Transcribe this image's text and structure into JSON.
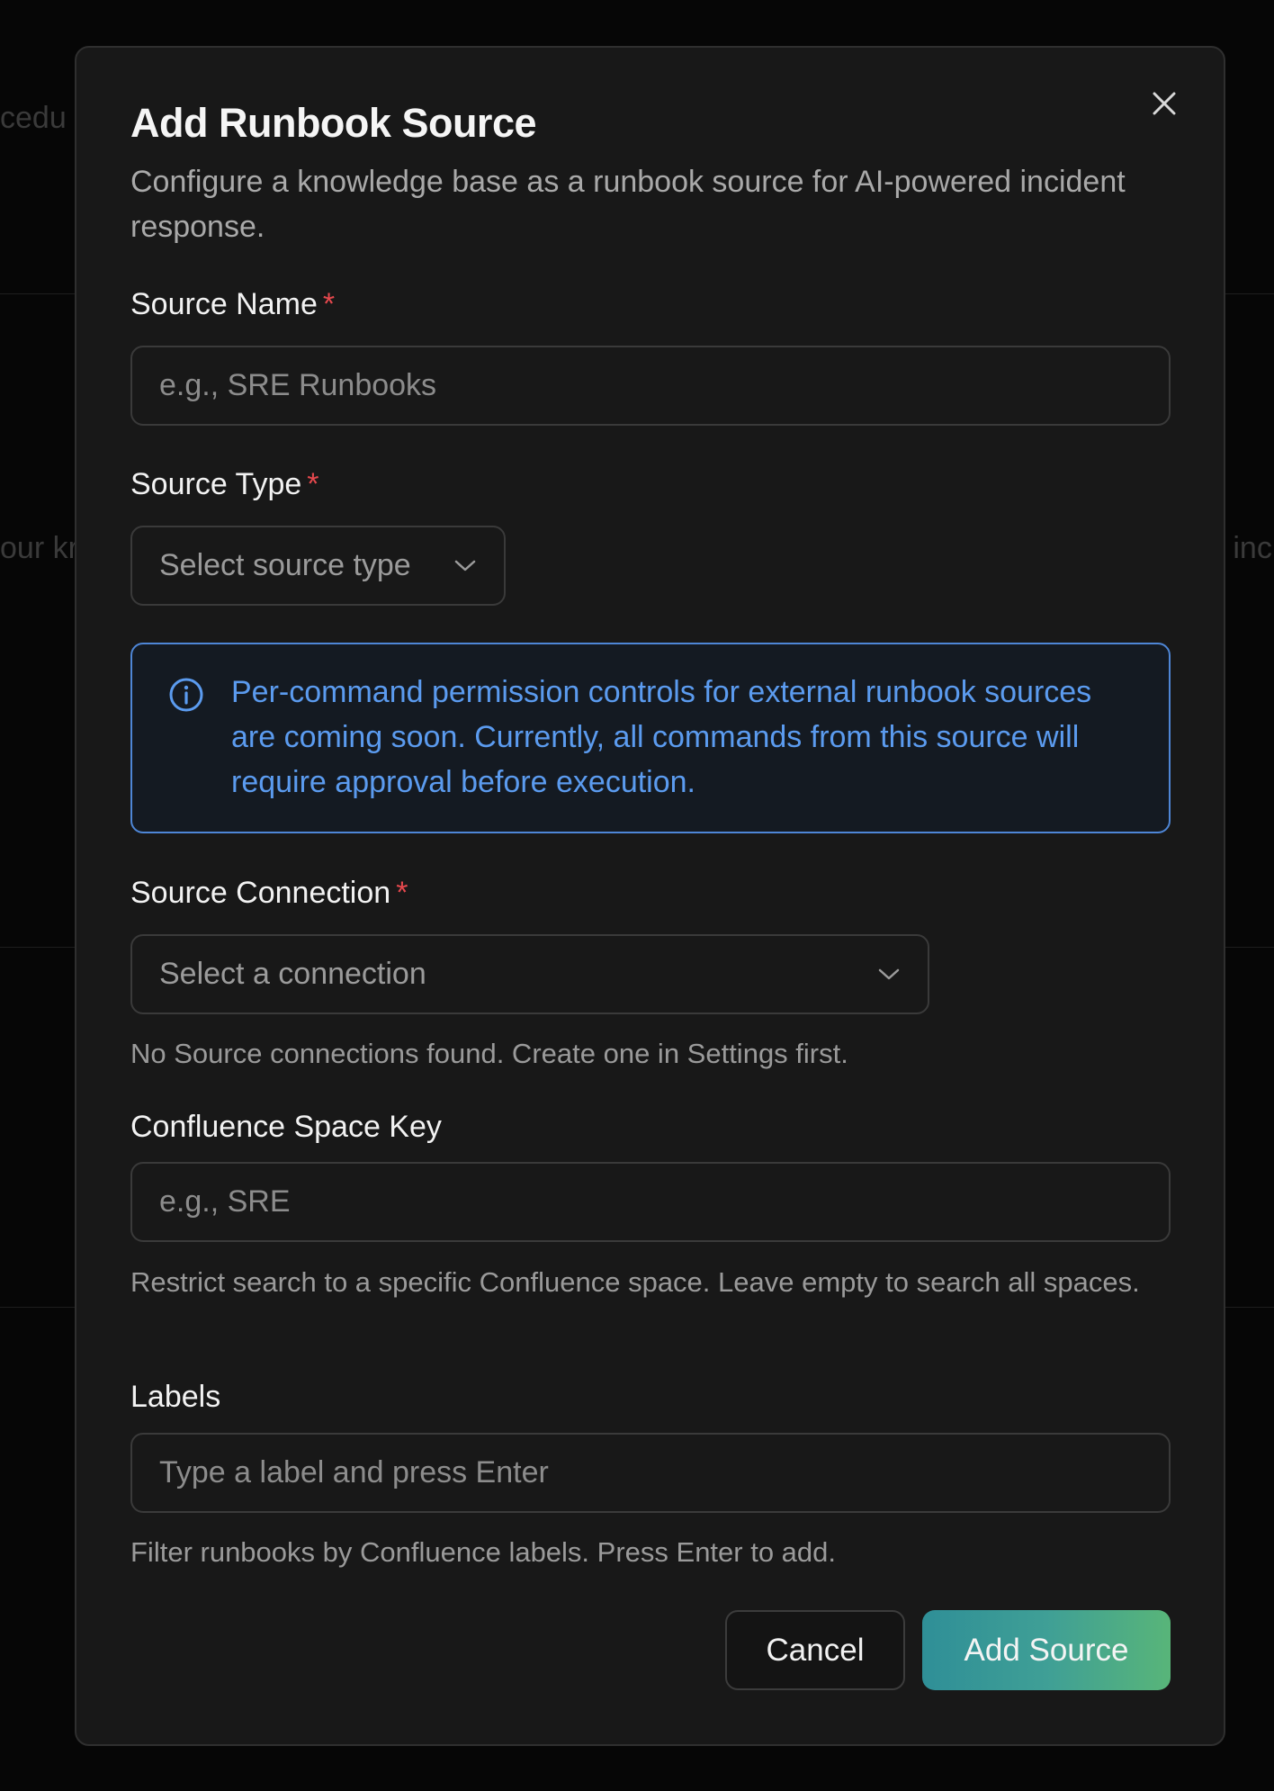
{
  "background": {
    "text_left_top": "cedu",
    "text_left_mid": "our kr",
    "text_right_mid": "g inc"
  },
  "dialog": {
    "title": "Add Runbook Source",
    "description": "Configure a knowledge base as a runbook source for AI-powered incident response.",
    "close_icon": "close-icon"
  },
  "source_name": {
    "label": "Source Name",
    "required_mark": "*",
    "placeholder": "e.g., SRE Runbooks",
    "value": ""
  },
  "source_type": {
    "label": "Source Type",
    "required_mark": "*",
    "selected": "Select source type",
    "icon": "chevron-down-icon"
  },
  "info_notice": {
    "icon": "info-icon",
    "text": "Per-command permission controls for external runbook sources are coming soon. Currently, all commands from this source will require approval before execution."
  },
  "source_connection": {
    "label": "Source Connection",
    "required_mark": "*",
    "selected": "Select a connection",
    "icon": "chevron-down-icon",
    "hint": "No Source connections found. Create one in Settings first."
  },
  "space_key": {
    "label": "Confluence Space Key",
    "placeholder": "e.g., SRE",
    "value": "",
    "hint": "Restrict search to a specific Confluence space. Leave empty to search all spaces."
  },
  "labels": {
    "label": "Labels",
    "placeholder": "Type a label and press Enter",
    "value": "",
    "hint": "Filter runbooks by Confluence labels. Press Enter to add."
  },
  "actions": {
    "cancel_label": "Cancel",
    "submit_label": "Add Source"
  },
  "colors": {
    "accent_info": "#5b9bef",
    "required": "#e5484d",
    "submit_gradient_start": "#2f8f97",
    "submit_gradient_end": "#58b579"
  }
}
